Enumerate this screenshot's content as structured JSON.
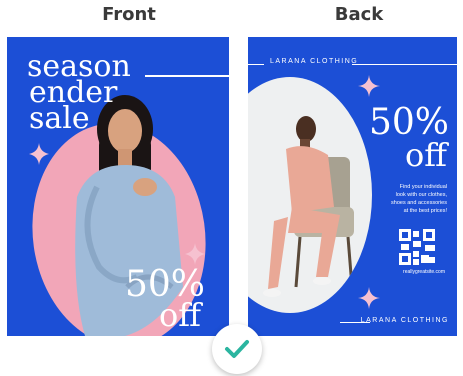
{
  "labels": {
    "front": "Front",
    "back": "Back"
  },
  "front": {
    "headline": [
      "season",
      "ender",
      "sale"
    ],
    "discount": "50%",
    "off": "off"
  },
  "back": {
    "brand_top": "LARANA CLOTHING",
    "discount": "50%",
    "off": "off",
    "description": [
      "Find your individual",
      "look with our clothes,",
      "shoes and accessories",
      "at the best prices!"
    ],
    "website": "reallygreatsite.com",
    "brand_bottom": "LARANA CLOTHING"
  },
  "colors": {
    "accent": "#1c4fd6",
    "pink": "#f2a6b8",
    "check": "#2bb5a0"
  }
}
